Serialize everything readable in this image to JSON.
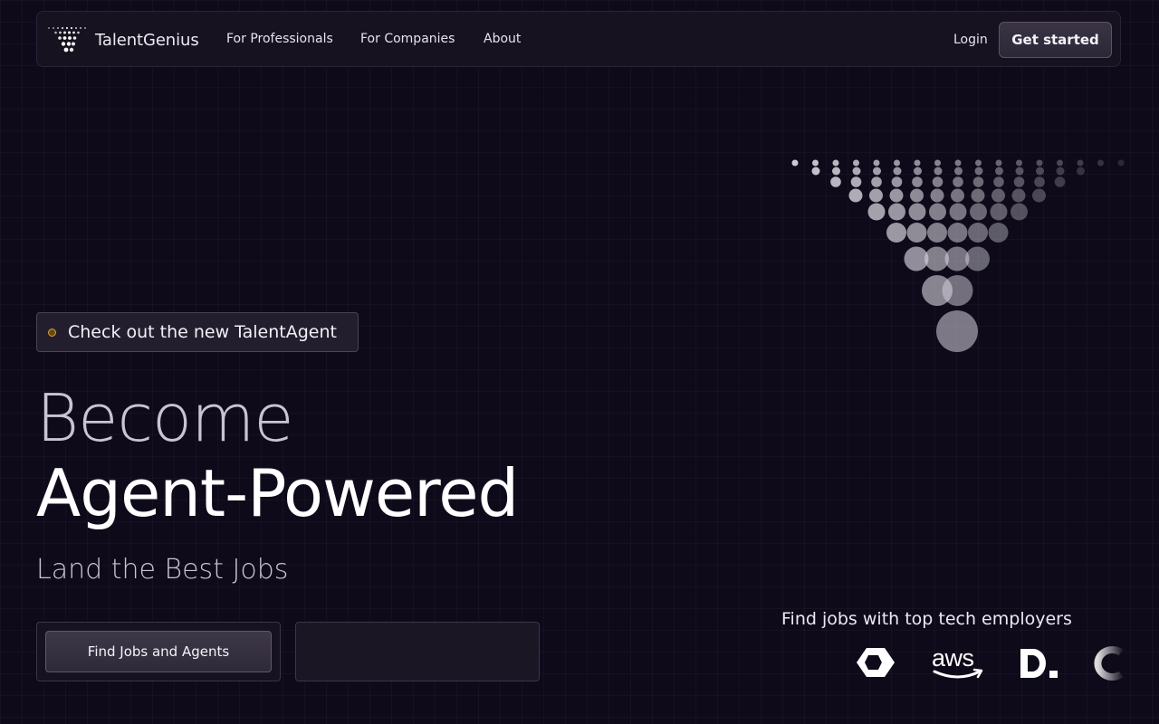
{
  "nav": {
    "brand": "TalentGenius",
    "links": [
      "For Professionals",
      "For Companies",
      "About"
    ],
    "login": "Login",
    "cta": "Get started"
  },
  "announcement": {
    "text": "Check out the new TalentAgent"
  },
  "hero": {
    "line1": "Become",
    "line2": "Agent-Powered",
    "subtitle": "Land the Best Jobs",
    "cta": "Find Jobs and Agents"
  },
  "employers": {
    "label": "Find jobs with top tech employers",
    "logos": [
      "hexagon-logo",
      "aws-logo",
      "d-logo",
      "c-logo"
    ]
  },
  "colors": {
    "background": "#0e0a1a",
    "accent_dot": "#d7a032",
    "button": "#2f2a39"
  }
}
